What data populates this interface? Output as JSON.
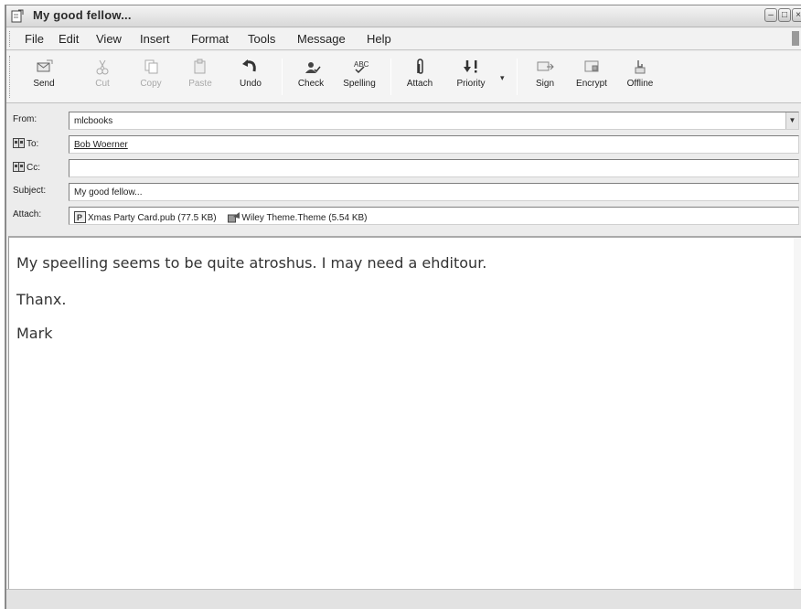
{
  "window": {
    "title": "My good fellow..."
  },
  "menu": {
    "items": [
      {
        "label": "File"
      },
      {
        "label": "Edit"
      },
      {
        "label": "View"
      },
      {
        "label": "Insert"
      },
      {
        "label": "Format"
      },
      {
        "label": "Tools"
      },
      {
        "label": "Message"
      },
      {
        "label": "Help"
      }
    ]
  },
  "toolbar": {
    "send": "Send",
    "cut": "Cut",
    "copy": "Copy",
    "paste": "Paste",
    "undo": "Undo",
    "check": "Check",
    "spelling": "Spelling",
    "attach": "Attach",
    "priority": "Priority",
    "sign": "Sign",
    "encrypt": "Encrypt",
    "offline": "Offline"
  },
  "headers": {
    "from_label": "From:",
    "from_value": "mlcbooks",
    "to_label": "To:",
    "to_value": "Bob Woerner",
    "cc_label": "Cc:",
    "cc_value": "",
    "subject_label": "Subject:",
    "subject_value": "My good fellow...",
    "attach_label": "Attach:",
    "attachments": [
      {
        "name": "Xmas Party Card.pub (77.5 KB)",
        "icon": "publisher-file-icon"
      },
      {
        "name": "Wiley Theme.Theme (5.54 KB)",
        "icon": "theme-file-icon"
      }
    ]
  },
  "body": {
    "line1": "My speelling seems to be quite atroshus. I may need a ehditour.",
    "line2": "Thanx.",
    "line3": "Mark"
  },
  "colors": {
    "chrome": "#ececec",
    "field_border": "#7f7f7f",
    "text": "#333333"
  }
}
